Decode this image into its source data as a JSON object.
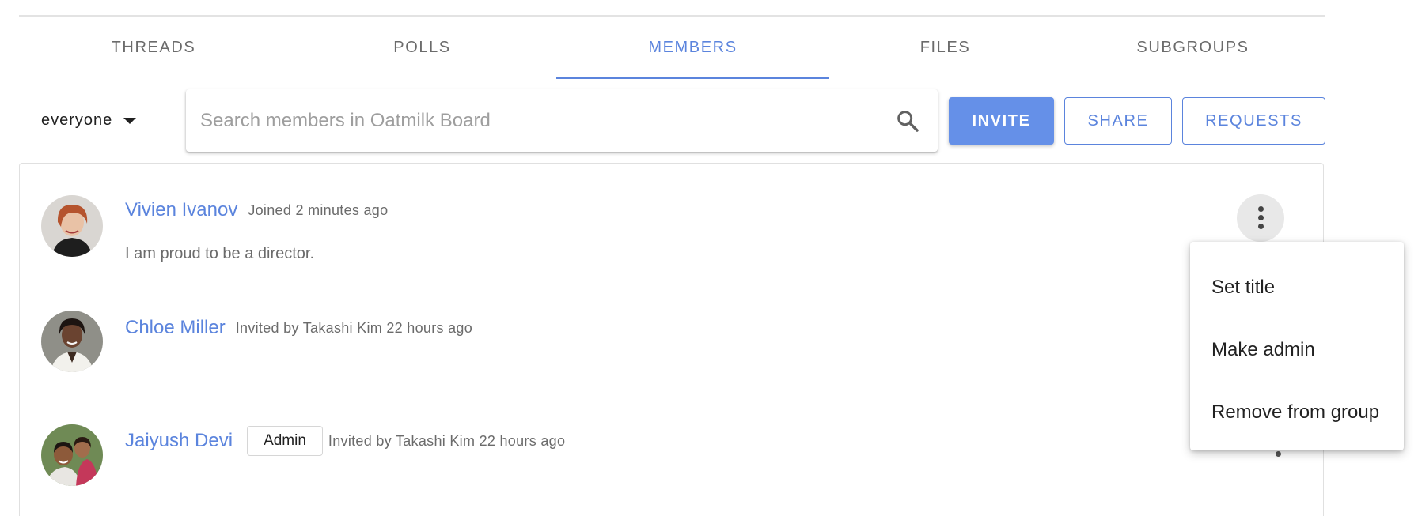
{
  "tabs": [
    {
      "label": "THREADS"
    },
    {
      "label": "POLLS"
    },
    {
      "label": "MEMBERS"
    },
    {
      "label": "FILES"
    },
    {
      "label": "SUBGROUPS"
    }
  ],
  "active_tab": "MEMBERS",
  "filter": {
    "selected": "everyone"
  },
  "search": {
    "placeholder": "Search members in Oatmilk Board",
    "value": ""
  },
  "buttons": {
    "invite": "INVITE",
    "share": "SHARE",
    "requests": "REQUESTS"
  },
  "members": [
    {
      "name": "Vivien Ivanov",
      "meta": "Joined 2 minutes ago",
      "bio": "I am proud to be a director."
    },
    {
      "name": "Chloe Miller",
      "meta": "Invited by Takashi Kim 22 hours ago"
    },
    {
      "name": "Jaiyush Devi",
      "badge": "Admin",
      "meta": "Invited by Takashi Kim 22 hours ago"
    }
  ],
  "menu": {
    "items": [
      {
        "label": "Set title"
      },
      {
        "label": "Make admin"
      },
      {
        "label": "Remove from group"
      }
    ]
  },
  "colors": {
    "accent": "#5b84dd",
    "invite_bg": "#6590e8",
    "muted_text": "#6b6b6b"
  },
  "icons": [
    "chevron-down-icon",
    "search-icon",
    "more-vert-icon"
  ]
}
